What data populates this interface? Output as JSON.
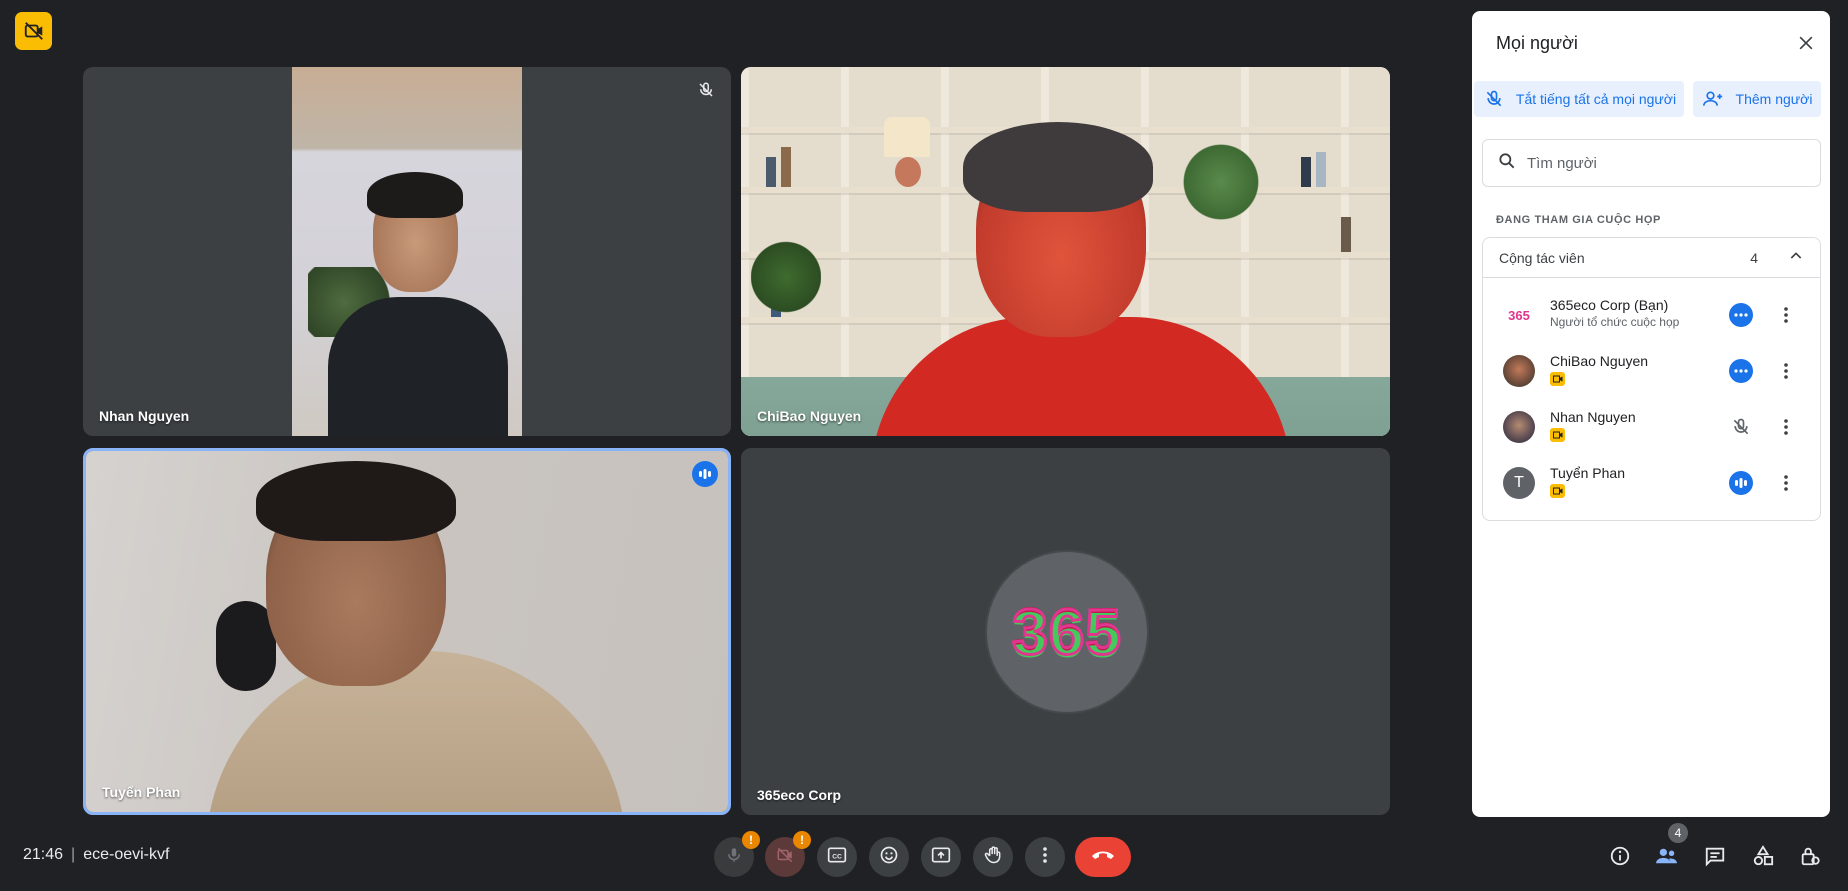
{
  "meeting": {
    "time": "21:46",
    "separator": "|",
    "code": "ece-oevi-kvf"
  },
  "tiles": [
    {
      "name": "Nhan Nguyen",
      "mic": "muted"
    },
    {
      "name": "ChiBao Nguyen",
      "mic": "on"
    },
    {
      "name": "Tuyển Phan",
      "mic": "speaking"
    },
    {
      "name": "365eco Corp",
      "mic": "on",
      "avatar_text": "365"
    }
  ],
  "panel": {
    "title": "Mọi người",
    "mute_all_label": "Tắt tiếng tất cả mọi người",
    "add_label": "Thêm người",
    "search_placeholder": "Tìm người",
    "section_label": "ĐANG THAM GIA CUỘC HỌP",
    "group_name": "Cộng tác viên",
    "group_count": "4",
    "participants": [
      {
        "name": "365eco Corp (Bạn)",
        "sub": "Người tổ chức cuộc họp",
        "status": "more-dots-icon",
        "avatar_text": "365"
      },
      {
        "name": "ChiBao Nguyen",
        "sub": "",
        "status": "more-dots-icon"
      },
      {
        "name": "Nhan Nguyen",
        "sub": "",
        "status": "mic-off-icon"
      },
      {
        "name": "Tuyển Phan",
        "sub": "",
        "status": "speaking-icon",
        "avatar_text": "T"
      }
    ]
  },
  "controls": {
    "warning_mark": "!",
    "people_count": "4",
    "icons": [
      "mic-icon",
      "camera-off-icon",
      "captions-icon",
      "emoji-icon",
      "present-icon",
      "raise-hand-icon",
      "more-options-icon",
      "end-call-icon",
      "info-icon",
      "people-icon",
      "chat-icon",
      "activities-icon",
      "host-controls-icon"
    ]
  },
  "colors": {
    "background": "#202124",
    "accent": "#1a73e8",
    "end_call": "#ea4335",
    "warning": "#ea8600",
    "camera_badge": "#fbbc04"
  }
}
